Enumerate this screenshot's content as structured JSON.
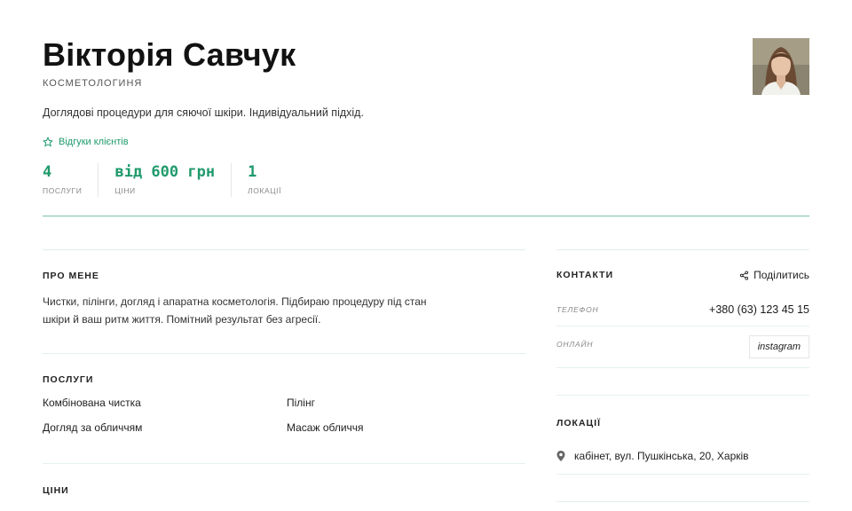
{
  "profile": {
    "name": "Вікторія Савчук",
    "role": "КОСМЕТОЛОГИНЯ",
    "tagline": "Доглядові процедури для сяючої шкіри. Індивідуальний підхід.",
    "reviews_link": "Відгуки клієнтів",
    "avatar_icon": "portrait-photo"
  },
  "stats": [
    {
      "value": "4",
      "label": "ПОСЛУГИ"
    },
    {
      "value": "від 600 грн",
      "label": "ЦІНИ"
    },
    {
      "value": "1",
      "label": "ЛОКАЦІЇ"
    }
  ],
  "about": {
    "title": "ПРО МЕНЕ",
    "text": "Чистки, пілінги, догляд і апаратна косметологія. Підбираю процедуру під стан шкіри й ваш ритм життя. Помітний результат без агресії."
  },
  "services": {
    "title": "ПОСЛУГИ",
    "items": [
      "Комбінована чистка",
      "Пілінг",
      "Догляд за обличчям",
      "Масаж обличчя"
    ]
  },
  "prices": {
    "title": "ЦІНИ"
  },
  "contacts": {
    "title": "КОНТАКТИ",
    "share_label": "Поділитись",
    "phone_label": "ТЕЛЕФОН",
    "phone": "+380 (63) 123 45 15",
    "online_label": "ОНЛАЙН",
    "instagram": "instagram"
  },
  "locations": {
    "title": "ЛОКАЦІЇ",
    "items": [
      "кабінет, вул. Пушкінська, 20, Харків"
    ]
  },
  "colors": {
    "accent": "#1f9a6c",
    "divider": "#7cc4a4",
    "text": "#1a1a1a"
  }
}
